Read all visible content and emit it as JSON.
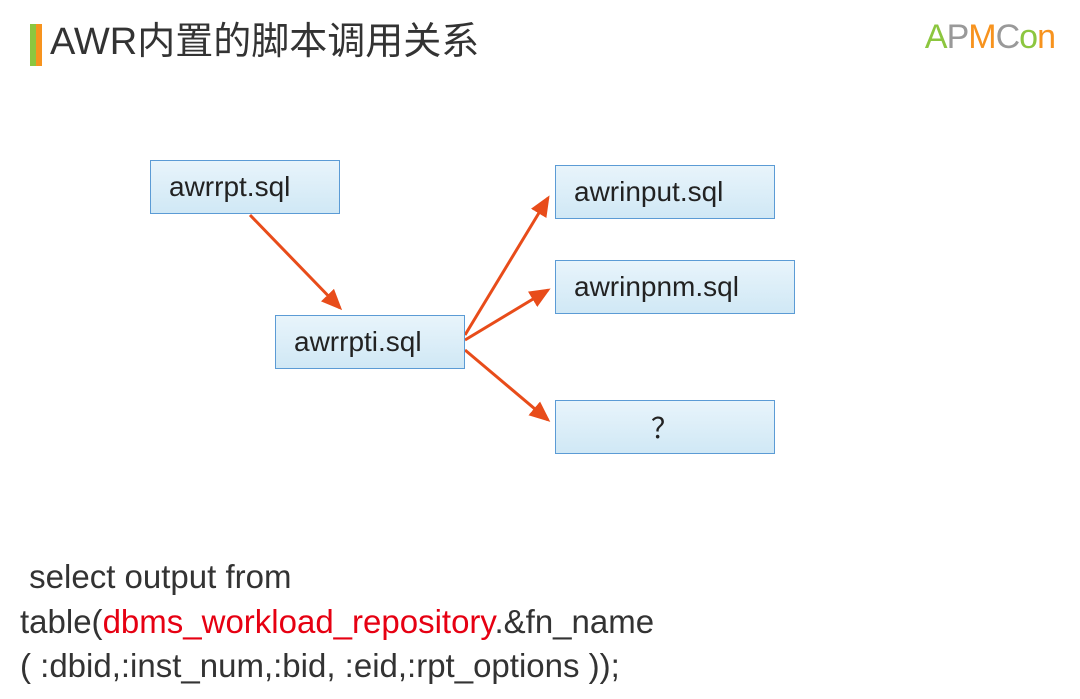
{
  "header": {
    "title": "AWR内置的脚本调用关系",
    "logo": {
      "a": "A",
      "p": "P",
      "m": "M",
      "c": "C",
      "o": "o",
      "n": "n"
    }
  },
  "diagram": {
    "nodes": {
      "awrrpt": "awrrpt.sql",
      "awrrpti": "awrrpti.sql",
      "awrinput": "awrinput.sql",
      "awrinpnm": "awrinpnm.sql",
      "question": "？"
    },
    "edges": [
      {
        "from": "awrrpt",
        "to": "awrrpti"
      },
      {
        "from": "awrrpti",
        "to": "awrinput"
      },
      {
        "from": "awrrpti",
        "to": "awrinpnm"
      },
      {
        "from": "awrrpti",
        "to": "question"
      }
    ]
  },
  "code": {
    "line1_pre": " select output from",
    "line2_pre": "table(",
    "line2_red": "dbms_workload_repository",
    "line2_post": ".&fn_name",
    "line3": "( :dbid,:inst_num,:bid, :eid,:rpt_options ));"
  }
}
